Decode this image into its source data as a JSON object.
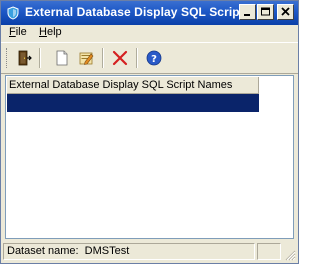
{
  "window": {
    "title": "External Database Display SQL Scripts",
    "icon": "shield-app-icon",
    "controls": {
      "minimize": "minimize-icon",
      "maximize": "maximize-icon",
      "close": "close-icon"
    }
  },
  "menubar": {
    "file_accel": "F",
    "file_rest": "ile",
    "help_accel": "H",
    "help_rest": "elp"
  },
  "toolbar": {
    "buttons": [
      "exit-door-icon",
      "new-document-icon",
      "edit-document-icon",
      "delete-x-icon",
      "help-circle-icon"
    ]
  },
  "list": {
    "column_header": "External Database Display SQL Script Names",
    "selected_row_color": "#0a246a"
  },
  "statusbar": {
    "dataset_label": "Dataset name:",
    "dataset_value": "DMSTest"
  },
  "colors": {
    "titlebar": "#0a3fa8",
    "window_bg": "#ece9d8"
  }
}
